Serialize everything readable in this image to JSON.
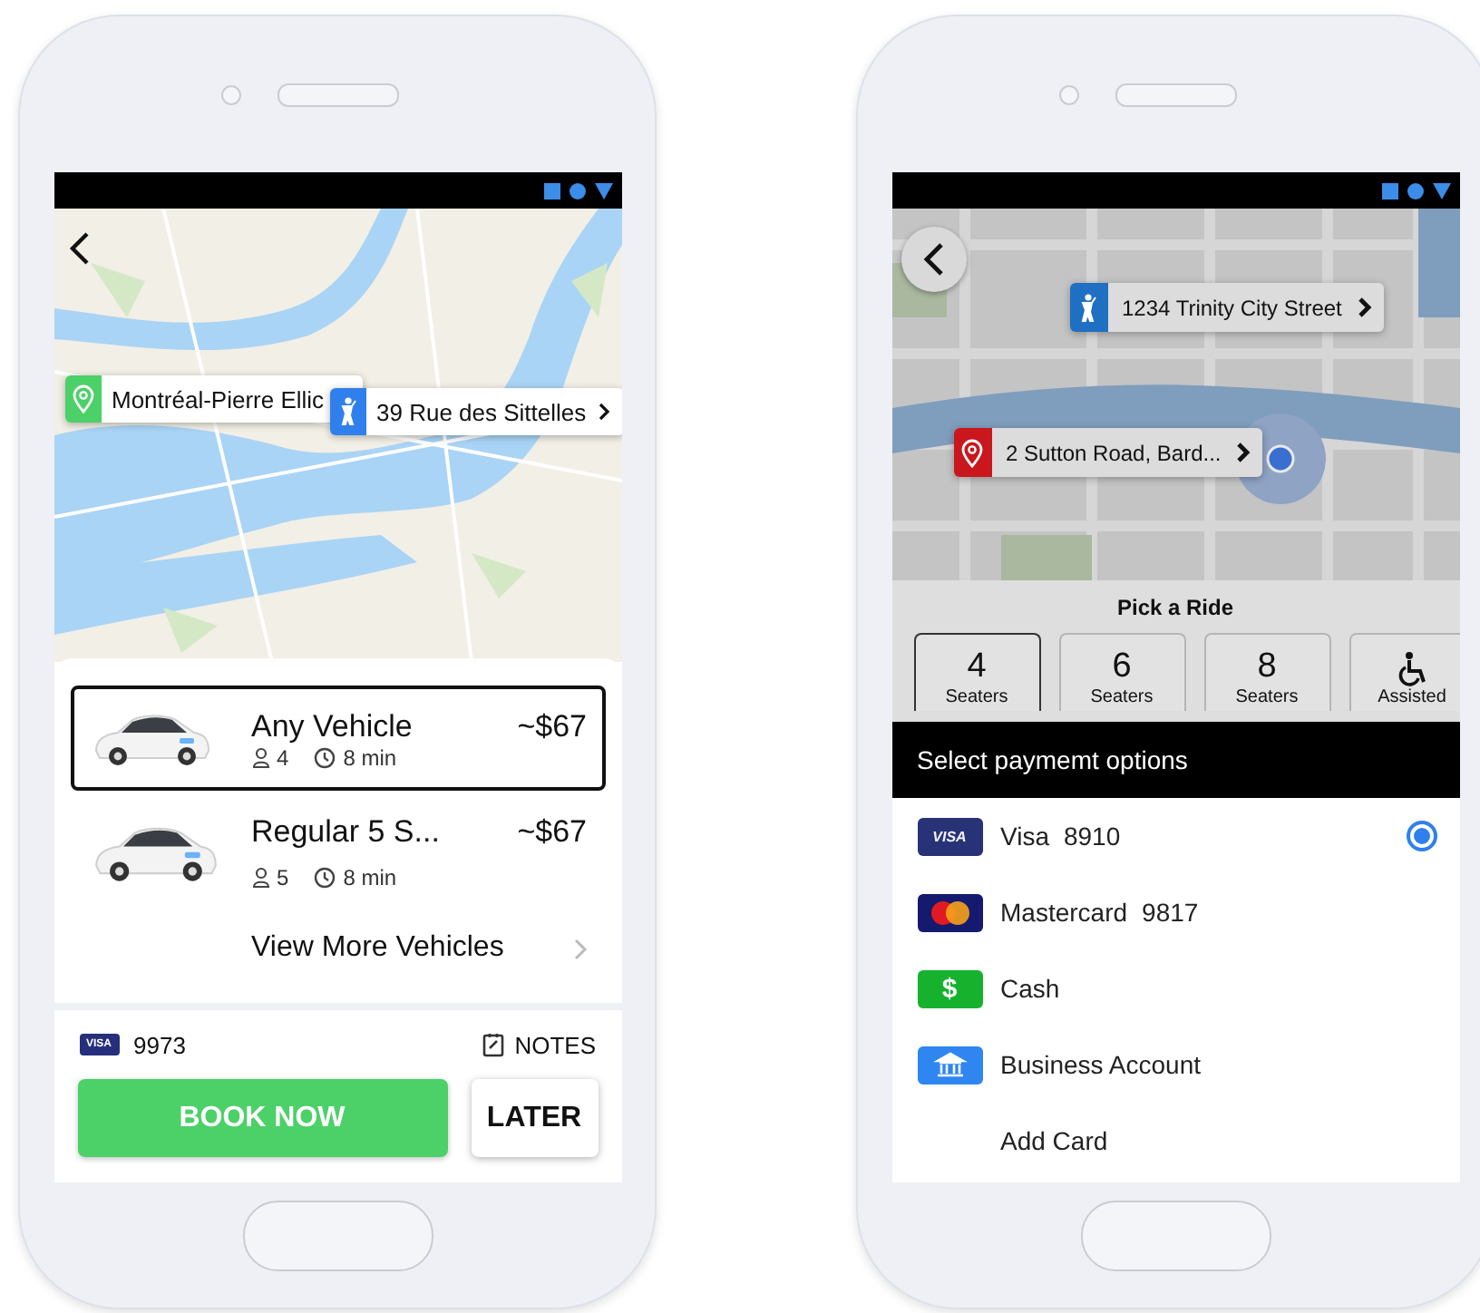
{
  "booking_screen": {
    "map": {
      "callouts": [
        {
          "kind": "pickup",
          "label": "Montréal-Pierre Ellic"
        },
        {
          "kind": "walk",
          "label": "39 Rue des Sittelles"
        }
      ]
    },
    "vehicles": [
      {
        "kind": "option",
        "name": "Any Vehicle",
        "price": "~$67",
        "seats": "4",
        "eta": "8 min",
        "selected": true
      },
      {
        "kind": "option",
        "name": "Regular 5 S...",
        "price": "~$67",
        "seats": "5",
        "eta": "8 min",
        "selected": false
      },
      {
        "kind": "more",
        "name": "View More Vehicles",
        "selected": false
      }
    ],
    "payment": {
      "badge_text": "VISA",
      "card_number": "9973",
      "notes_label": "NOTES"
    },
    "buttons": {
      "book_now": "BOOK NOW",
      "later": "LATER"
    }
  },
  "payment_screen": {
    "map": {
      "callouts": [
        {
          "kind": "walk",
          "label": "1234 Trinity City Street"
        },
        {
          "kind": "pin",
          "label": "2 Sutton Road, Bard..."
        }
      ]
    },
    "ride_picker": {
      "title": "Pick a Ride",
      "options": [
        {
          "kind": "count",
          "value": "4",
          "label": "Seaters",
          "selected": true
        },
        {
          "kind": "count",
          "value": "6",
          "label": "Seaters",
          "selected": false
        },
        {
          "kind": "count",
          "value": "8",
          "label": "Seaters",
          "selected": false
        },
        {
          "kind": "icon",
          "label": "Assisted",
          "selected": false
        }
      ]
    },
    "payment_sheet": {
      "title": "Select paymemt options",
      "methods": [
        {
          "kind": "visa",
          "badge_text": "VISA",
          "name": "Visa",
          "number": "8910",
          "selected": true
        },
        {
          "kind": "mastercard",
          "name": "Mastercard",
          "number": "9817",
          "selected": false
        },
        {
          "kind": "cash",
          "badge_text": "$",
          "name": "Cash",
          "selected": false
        },
        {
          "kind": "bank",
          "name": "Business Account",
          "selected": false
        },
        {
          "kind": "add",
          "name": "Add Card",
          "selected": false
        }
      ]
    }
  }
}
